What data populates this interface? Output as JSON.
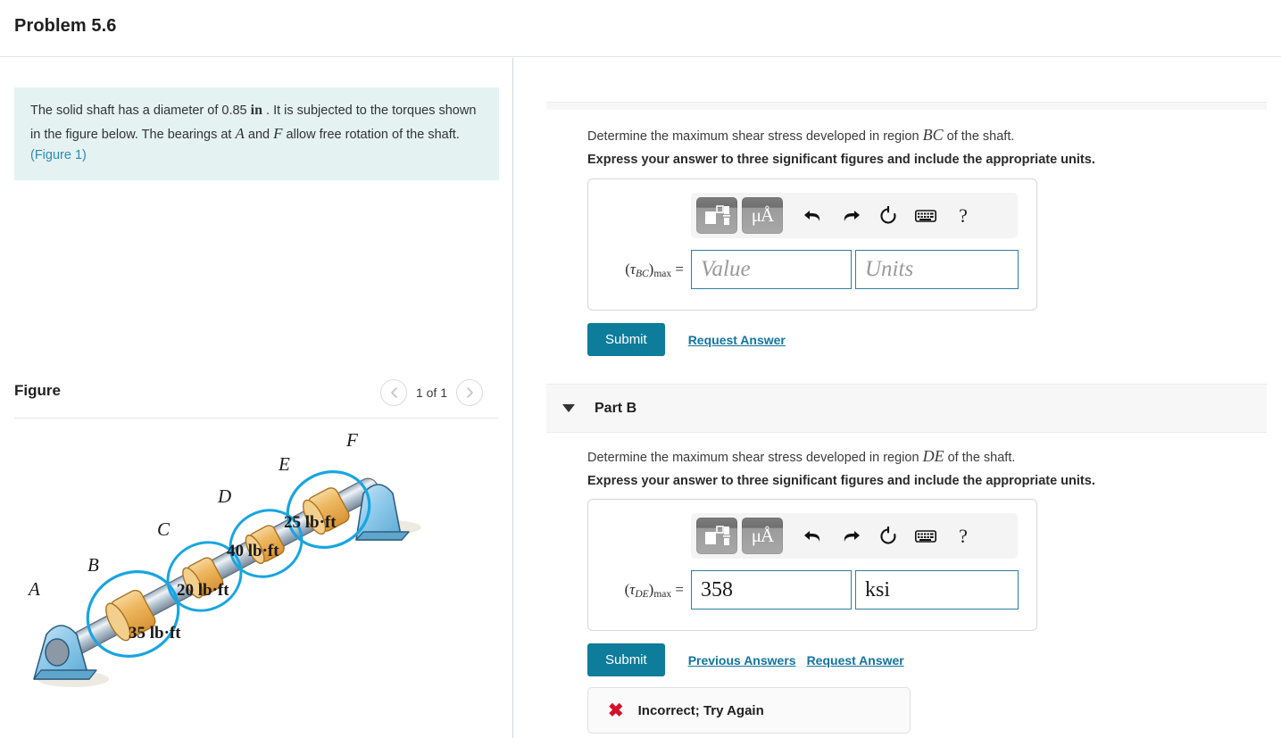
{
  "header": {
    "title": "Problem 5.6"
  },
  "left": {
    "description": {
      "text_1": "The solid shaft has a diameter of 0.85",
      "unit": "in",
      "text_2": ". It is subjected to the torques shown in the figure below. The bearings at",
      "var_a": "A",
      "text_3": "and",
      "var_f": "F",
      "text_4": "allow free rotation of the shaft.",
      "figure_link": "(Figure 1)"
    },
    "figure": {
      "label": "Figure",
      "counter": "1 of 1",
      "prev_icon": "chevron-left-icon",
      "next_icon": "chevron-right-icon",
      "diagram": {
        "points": [
          "A",
          "B",
          "C",
          "D",
          "E",
          "F"
        ],
        "torques": [
          "35 lb·ft",
          "20 lb·ft",
          "40 lb·ft",
          "25 lb·ft"
        ],
        "colors": {
          "shaft": "#b8c6d2",
          "collar": "#edb75c",
          "bearing": "#7fc3e8",
          "arrow": "#18a5e0"
        }
      }
    }
  },
  "right": {
    "partA": {
      "question_pre": "Determine the maximum shear stress developed in region",
      "question_region": "BC",
      "question_post": "of the shaft.",
      "instruction": "Express your answer to three significant figures and include the appropriate units.",
      "toolbar": {
        "template_icon": "math-template-icon",
        "units_icon": "micro-angstrom-units-icon",
        "undo_icon": "undo-arrow-icon",
        "redo_icon": "redo-arrow-icon",
        "reset_icon": "reset-circle-icon",
        "keyboard_icon": "keyboard-icon",
        "help_icon": "question-mark-icon",
        "units_label": "μÅ",
        "help_label": "?"
      },
      "answer": {
        "label_open": "(",
        "label_tau": "τ",
        "label_sub": "BC",
        "label_close": ")",
        "label_max": "max",
        "label_eq": "=",
        "value": "",
        "value_placeholder": "Value",
        "units": "",
        "units_placeholder": "Units"
      },
      "actions": {
        "submit": "Submit",
        "request_answer": "Request Answer"
      }
    },
    "partB": {
      "title": "Part B",
      "caret_icon": "caret-down-icon",
      "question_pre": "Determine the maximum shear stress developed in region",
      "question_region": "DE",
      "question_post": "of the shaft.",
      "instruction": "Express your answer to three significant figures and include the appropriate units.",
      "toolbar": {
        "template_icon": "math-template-icon",
        "units_icon": "micro-angstrom-units-icon",
        "undo_icon": "undo-arrow-icon",
        "redo_icon": "redo-arrow-icon",
        "reset_icon": "reset-circle-icon",
        "keyboard_icon": "keyboard-icon",
        "help_icon": "question-mark-icon",
        "units_label": "μÅ",
        "help_label": "?"
      },
      "answer": {
        "label_open": "(",
        "label_tau": "τ",
        "label_sub": "DE",
        "label_close": ")",
        "label_max": "max",
        "label_eq": "=",
        "value": "358",
        "value_placeholder": "Value",
        "units": "ksi",
        "units_placeholder": "Units"
      },
      "actions": {
        "submit": "Submit",
        "previous_answers": "Previous Answers",
        "request_answer": "Request Answer"
      },
      "feedback": {
        "icon": "red-x-icon",
        "icon_glyph": "✖",
        "text": "Incorrect; Try Again"
      }
    }
  },
  "colors": {
    "accent": "#0e7c9b",
    "link": "#1274a0",
    "description_bg": "#e4f2f2",
    "error": "#d6102a"
  }
}
